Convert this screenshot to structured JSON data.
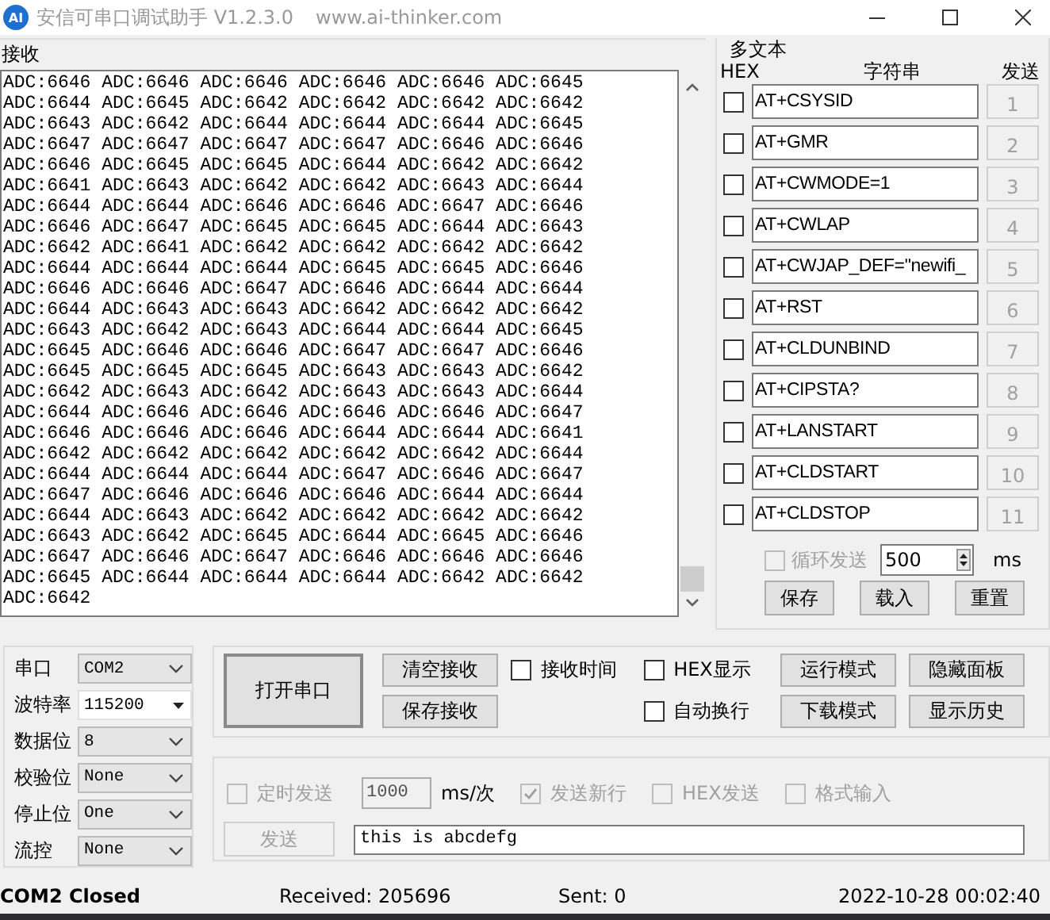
{
  "window": {
    "logo": "AI",
    "title": "安信可串口调试助手 V1.2.3.0",
    "url": "www.ai-thinker.com"
  },
  "receive": {
    "label": "接收",
    "lines": [
      "ADC:6646 ADC:6646 ADC:6646 ADC:6646 ADC:6646 ADC:6645",
      "ADC:6644 ADC:6645 ADC:6642 ADC:6642 ADC:6642 ADC:6642",
      "ADC:6643 ADC:6642 ADC:6644 ADC:6644 ADC:6644 ADC:6645",
      "ADC:6647 ADC:6647 ADC:6647 ADC:6647 ADC:6646 ADC:6646",
      "ADC:6646 ADC:6645 ADC:6645 ADC:6644 ADC:6642 ADC:6642",
      "ADC:6641 ADC:6643 ADC:6642 ADC:6642 ADC:6643 ADC:6644",
      "ADC:6644 ADC:6644 ADC:6646 ADC:6646 ADC:6647 ADC:6646",
      "ADC:6646 ADC:6647 ADC:6645 ADC:6645 ADC:6644 ADC:6643",
      "ADC:6642 ADC:6641 ADC:6642 ADC:6642 ADC:6642 ADC:6642",
      "ADC:6644 ADC:6644 ADC:6644 ADC:6645 ADC:6645 ADC:6646",
      "ADC:6646 ADC:6646 ADC:6647 ADC:6646 ADC:6644 ADC:6644",
      "ADC:6644 ADC:6643 ADC:6643 ADC:6642 ADC:6642 ADC:6642",
      "ADC:6643 ADC:6642 ADC:6643 ADC:6644 ADC:6644 ADC:6645",
      "ADC:6645 ADC:6646 ADC:6646 ADC:6647 ADC:6647 ADC:6646",
      "ADC:6645 ADC:6645 ADC:6645 ADC:6643 ADC:6643 ADC:6642",
      "ADC:6642 ADC:6643 ADC:6642 ADC:6643 ADC:6643 ADC:6644",
      "ADC:6644 ADC:6646 ADC:6646 ADC:6646 ADC:6646 ADC:6647",
      "ADC:6646 ADC:6646 ADC:6646 ADC:6644 ADC:6644 ADC:6641",
      "ADC:6642 ADC:6642 ADC:6642 ADC:6642 ADC:6642 ADC:6644",
      "ADC:6644 ADC:6644 ADC:6644 ADC:6647 ADC:6646 ADC:6647",
      "ADC:6647 ADC:6646 ADC:6646 ADC:6646 ADC:6644 ADC:6644",
      "ADC:6644 ADC:6643 ADC:6642 ADC:6642 ADC:6642 ADC:6642",
      "ADC:6643 ADC:6642 ADC:6645 ADC:6644 ADC:6645 ADC:6646",
      "ADC:6647 ADC:6646 ADC:6647 ADC:6646 ADC:6646 ADC:6646",
      "ADC:6645 ADC:6644 ADC:6644 ADC:6644 ADC:6642 ADC:6642",
      "ADC:6642"
    ]
  },
  "multi_text": {
    "title": "多文本",
    "headers": [
      "HEX",
      "字符串",
      "发送"
    ],
    "rows": [
      {
        "hex": false,
        "value": "AT+CSYSID",
        "button": "1",
        "disabled": true
      },
      {
        "hex": false,
        "value": "AT+GMR",
        "button": "2",
        "disabled": true
      },
      {
        "hex": false,
        "value": "AT+CWMODE=1",
        "button": "3",
        "disabled": true
      },
      {
        "hex": false,
        "value": "AT+CWLAP",
        "button": "4",
        "disabled": true
      },
      {
        "hex": false,
        "value": "AT+CWJAP_DEF=\"newifi_",
        "button": "5",
        "disabled": true
      },
      {
        "hex": false,
        "value": "AT+RST",
        "button": "6",
        "disabled": true
      },
      {
        "hex": false,
        "value": "AT+CLDUNBIND",
        "button": "7",
        "disabled": true
      },
      {
        "hex": false,
        "value": "AT+CIPSTA?",
        "button": "8",
        "disabled": true
      },
      {
        "hex": false,
        "value": "AT+LANSTART",
        "button": "9",
        "disabled": true
      },
      {
        "hex": false,
        "value": "AT+CLDSTART",
        "button": "10",
        "disabled": true
      },
      {
        "hex": false,
        "value": "AT+CLDSTOP",
        "button": "11",
        "disabled": true
      }
    ],
    "loop": {
      "label": "循环发送",
      "checked": false,
      "disabled": true,
      "value": "500",
      "unit": "ms"
    },
    "buttons": [
      "保存",
      "载入",
      "重置"
    ]
  },
  "port_settings": [
    {
      "label": "串口",
      "value": "COM2",
      "kind": "dropdown"
    },
    {
      "label": "波特率",
      "value": "115200",
      "kind": "combo"
    },
    {
      "label": "数据位",
      "value": "8",
      "kind": "dropdown"
    },
    {
      "label": "校验位",
      "value": "None",
      "kind": "dropdown"
    },
    {
      "label": "停止位",
      "value": "One",
      "kind": "dropdown"
    },
    {
      "label": "流控",
      "value": "None",
      "kind": "dropdown"
    }
  ],
  "open_button": "打开串口",
  "receive_buttons": [
    "清空接收",
    "保存接收"
  ],
  "receive_options": [
    {
      "label": "接收时间",
      "checked": false
    },
    {
      "label": "HEX显示",
      "checked": false
    },
    {
      "label": "自动换行",
      "checked": false
    }
  ],
  "mode_buttons": [
    "运行模式",
    "下载模式"
  ],
  "panel_buttons": [
    "隐藏面板",
    "显示历史"
  ],
  "send": {
    "options": [
      {
        "kind": "checkbox",
        "label": "定时发送",
        "checked": false,
        "disabled": true
      },
      {
        "kind": "field",
        "value": "1000",
        "disabled": true
      },
      {
        "kind": "unit",
        "label": "ms/次"
      },
      {
        "kind": "checkbox",
        "label": "发送新行",
        "checked": true,
        "disabled": true
      },
      {
        "kind": "checkbox",
        "label": "HEX发送",
        "checked": false,
        "disabled": true
      },
      {
        "kind": "checkbox",
        "label": "格式输入",
        "checked": false,
        "disabled": true
      }
    ],
    "button": "发送",
    "button_disabled": true,
    "text": "this is abcdefg"
  },
  "status_bar": {
    "port_status": "COM2 Closed",
    "received": "Received: 205696",
    "sent": "Sent: 0",
    "time": "2022-10-28 00:02:40"
  }
}
